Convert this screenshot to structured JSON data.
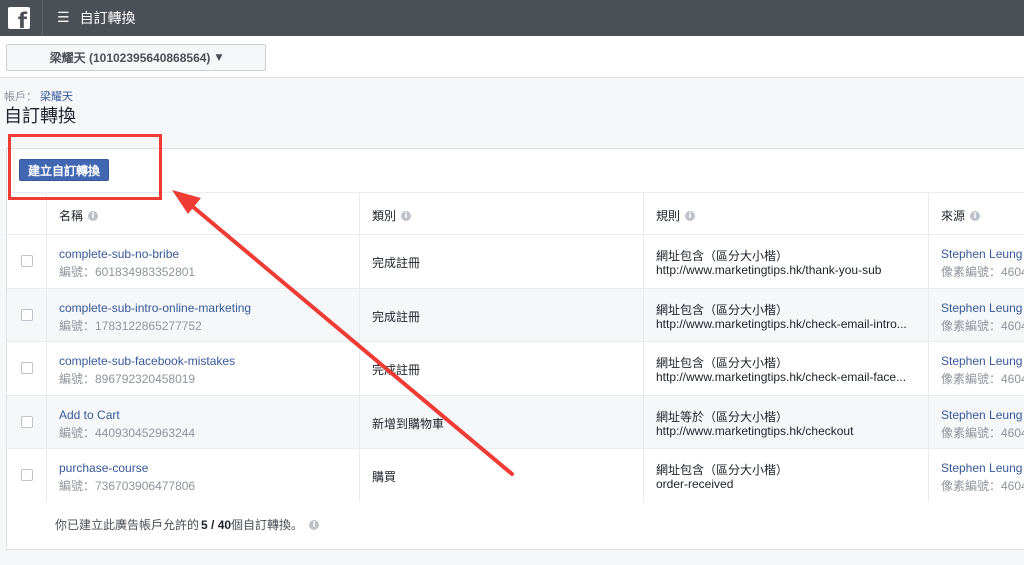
{
  "topbar": {
    "logo": "f",
    "menu_icon": "☰",
    "title": "自訂轉換"
  },
  "account": {
    "selected": "梁耀天 (10102395640868564)",
    "caret": "▼"
  },
  "breadcrumb": {
    "label": "帳戶：",
    "account_link": "梁耀天"
  },
  "page_title": "自訂轉換",
  "create_button": "建立自訂轉換",
  "info_glyph": "i",
  "table": {
    "headers": [
      "名稱",
      "類別",
      "規則",
      "來源"
    ],
    "rows": [
      {
        "name": "complete-sub-no-bribe",
        "id": "編號：601834983352801",
        "category": "完成註冊",
        "rule_type": "網址包含（區分大小楷）",
        "rule_url": "http://www.marketingtips.hk/thank-you-sub",
        "source_name": "Stephen Leung",
        "source_id": "像素編號：4604"
      },
      {
        "name": "complete-sub-intro-online-marketing",
        "id": "編號：1783122865277752",
        "category": "完成註冊",
        "rule_type": "網址包含（區分大小楷）",
        "rule_url": "http://www.marketingtips.hk/check-email-intro...",
        "source_name": "Stephen Leung",
        "source_id": "像素編號：4604"
      },
      {
        "name": "complete-sub-facebook-mistakes",
        "id": "編號：896792320458019",
        "category": "完成註冊",
        "rule_type": "網址包含（區分大小楷）",
        "rule_url": "http://www.marketingtips.hk/check-email-face...",
        "source_name": "Stephen Leung",
        "source_id": "像素編號：4604"
      },
      {
        "name": "Add to Cart",
        "id": "編號：440930452963244",
        "category": "新增到購物車",
        "rule_type": "網址等於（區分大小楷）",
        "rule_url": "http://www.marketingtips.hk/checkout",
        "source_name": "Stephen Leung",
        "source_id": "像素編號：4604"
      },
      {
        "name": "purchase-course",
        "id": "編號：736703906477806",
        "category": "購買",
        "rule_type": "網址包含（區分大小楷）",
        "rule_url": "order-received",
        "source_name": "Stephen Leung",
        "source_id": "像素編號：4604"
      }
    ]
  },
  "footer": {
    "prefix": "你已建立此廣告帳戶允許的",
    "count": "5 / 40",
    "suffix": "個自訂轉換。"
  },
  "colors": {
    "topbar": "#4b4f56",
    "primary_button": "#4267b2",
    "link": "#365899",
    "annotation": "#ee3b34"
  }
}
